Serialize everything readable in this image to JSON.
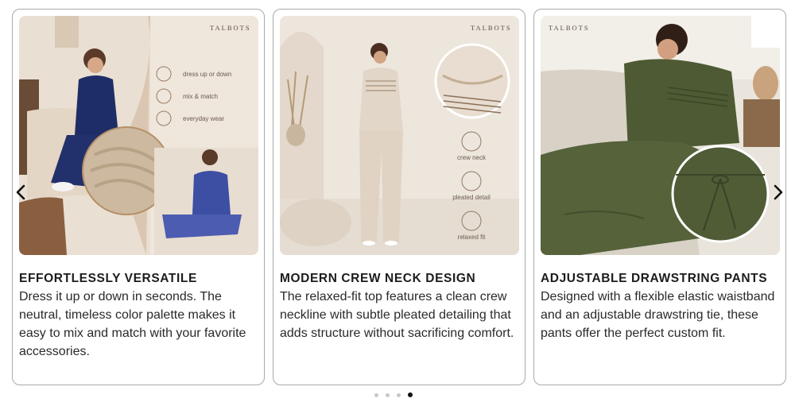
{
  "carousel": {
    "prev_label": "Previous",
    "next_label": "Next",
    "slides": [
      {
        "image": {
          "brand": "TALBOTS",
          "features": [
            "dress up or down",
            "mix & match",
            "everyday wear"
          ],
          "alt": "Woman in navy pleated sweater and pants set relaxing at home"
        },
        "title": "EFFORTLESSLY VERSATILE",
        "description": "Dress it up or down in seconds. The neutral, timeless color palette makes it easy to mix and match with your favorite accessories."
      },
      {
        "image": {
          "brand": "TALBOTS",
          "features": [
            "crew neck",
            "pleated detail",
            "relaxed fit"
          ],
          "alt": "Woman standing in oatmeal pleated crew neck top and wide leg pants"
        },
        "title": "MODERN CREW NECK DESIGN",
        "description": "The relaxed-fit top features a clean crew neckline with subtle pleated detailing that adds structure without sacrificing comfort."
      },
      {
        "image": {
          "brand": "TALBOTS",
          "features": [],
          "alt": "Woman in olive green lounge set showing drawstring waistband close-up"
        },
        "title": "ADJUSTABLE DRAWSTRING PANTS",
        "description": "Designed with a flexible elastic waistband and an adjustable drawstring tie, these pants offer the perfect custom fit."
      }
    ],
    "pagination": {
      "total": 4,
      "active": 4
    }
  },
  "colors": {
    "navy": "#1f2d66",
    "oatmeal": "#e2d6c8",
    "olive": "#4d5a33",
    "card_border": "#a9a9a9",
    "dot_active": "#111111",
    "dot_inactive": "#c8c8c8"
  }
}
